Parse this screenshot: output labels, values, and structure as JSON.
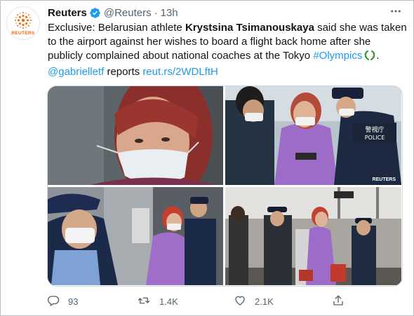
{
  "author": {
    "name": "Reuters",
    "handle": "@Reuters",
    "separator": "·",
    "time": "13h",
    "avatar_text": "REUTERS"
  },
  "tweet": {
    "t1": "Exclusive: Belarusian athlete ",
    "bold_name": "Krystsina Tsimanouskaya",
    "t2": " said she was taken to the airport against her wishes to board a flight back home after she publicly complained about national coaches at the Tokyo ",
    "hashtag": "#Olympics",
    "t3": ".",
    "mention": "@gabrielletf",
    "t4": " reports ",
    "url": "reut.rs/2WDLftH"
  },
  "media": {
    "watermark": "REUTERS",
    "police_vest_text": "警視庁",
    "police_vest_text2": "POLICE"
  },
  "actions": {
    "reply_count": "93",
    "retweet_count": "1.4K",
    "like_count": "2.1K"
  },
  "icons": {
    "verified": "verified-badge-icon",
    "more": "more-icon",
    "reply": "reply-icon",
    "retweet": "retweet-icon",
    "like": "heart-icon",
    "share": "share-icon",
    "olympics": "olympic-wreath-icon"
  },
  "colors": {
    "link": "#1d9bf0",
    "muted": "#536471",
    "reuters_orange": "#fa6400"
  }
}
